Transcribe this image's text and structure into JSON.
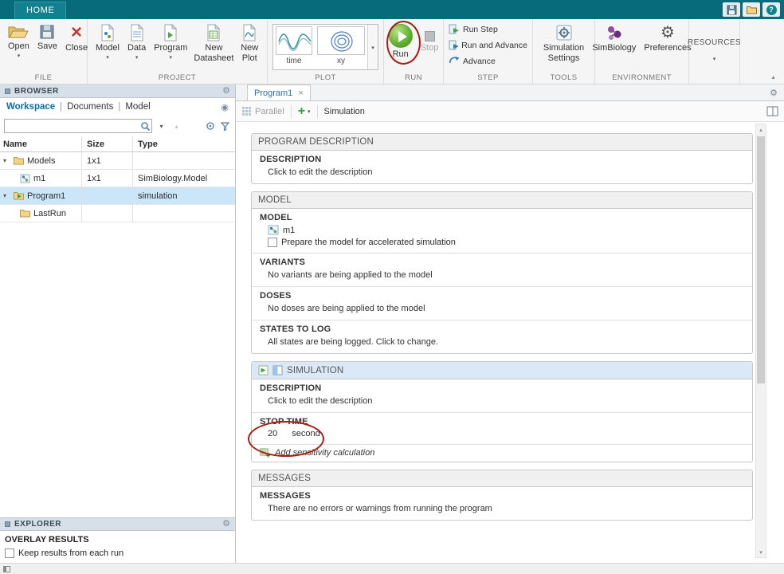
{
  "colors": {
    "titlebar_teal": "#076b7c",
    "selection_blue": "#cbe6f8",
    "simulation_header_blue": "#dbe9f7",
    "annotation_red": "#a91c10",
    "link_blue": "#0b6cae"
  },
  "icons": {
    "caret_down": "▾",
    "caret_up": "▴",
    "gear": "⚙",
    "close": "×",
    "plus": "+",
    "help": "?",
    "twisty_open": "▾",
    "collapse_up": "▲"
  },
  "titlebar": {
    "home_tab": "HOME"
  },
  "ribbon": {
    "file": {
      "label": "FILE",
      "open": "Open",
      "save": "Save",
      "close": "Close"
    },
    "project": {
      "label": "PROJECT",
      "model": "Model",
      "data": "Data",
      "program": "Program",
      "new_datasheet": "New Datasheet",
      "new_plot": "New Plot"
    },
    "plot": {
      "label": "PLOT",
      "time": "time",
      "xy": "xy"
    },
    "run_group": {
      "label": "RUN",
      "run": "Run",
      "stop": "Stop"
    },
    "step": {
      "label": "STEP",
      "run_step": "Run Step",
      "run_and_advance": "Run and Advance",
      "advance": "Advance"
    },
    "tools": {
      "label": "TOOLS",
      "simulation_settings": "Simulation Settings"
    },
    "environment": {
      "label": "ENVIRONMENT",
      "simbiology": "SimBiology",
      "preferences": "Preferences"
    },
    "resources": {
      "label": "RESOURCES"
    }
  },
  "browser": {
    "title": "BROWSER",
    "tabs": {
      "workspace": "Workspace",
      "documents": "Documents",
      "model": "Model",
      "separator": "|"
    },
    "search": {
      "value": ""
    },
    "table": {
      "columns": {
        "name": "Name",
        "size": "Size",
        "type": "Type"
      },
      "rows": [
        {
          "name": "Models",
          "size": "1x1",
          "type": ""
        },
        {
          "name": "m1",
          "size": "1x1",
          "type": "SimBiology.Model"
        },
        {
          "name": "Program1",
          "size": "",
          "type": "simulation"
        },
        {
          "name": "LastRun",
          "size": "",
          "type": ""
        }
      ]
    },
    "explorer_title": "EXPLORER",
    "overlay": {
      "title": "OVERLAY RESULTS",
      "keep_results_label": "Keep results from each run"
    }
  },
  "main": {
    "tab": "Program1",
    "toolbar": {
      "parallel": "Parallel",
      "simulation": "Simulation"
    },
    "program_description": {
      "header": "PROGRAM DESCRIPTION",
      "description_label": "DESCRIPTION",
      "description_text": "Click to edit the description"
    },
    "model_section": {
      "header": "MODEL",
      "model_label": "MODEL",
      "model_name": "m1",
      "prepare_label": "Prepare the model for accelerated simulation",
      "variants_label": "VARIANTS",
      "variants_text": "No variants are being applied to the model",
      "doses_label": "DOSES",
      "doses_text": "No doses are being applied to the model",
      "states_label": "STATES TO LOG",
      "states_text": "All states are being logged. Click to change."
    },
    "simulation_section": {
      "header": "SIMULATION",
      "description_label": "DESCRIPTION",
      "description_text": "Click to edit the description",
      "stop_time_label": "STOP TIME",
      "stop_time_value": "20",
      "stop_time_unit": "second",
      "sensitivity_link": "Add sensitivity calculation"
    },
    "messages_section": {
      "header": "MESSAGES",
      "messages_label": "MESSAGES",
      "messages_text": "There are no errors or warnings from running the program"
    }
  }
}
